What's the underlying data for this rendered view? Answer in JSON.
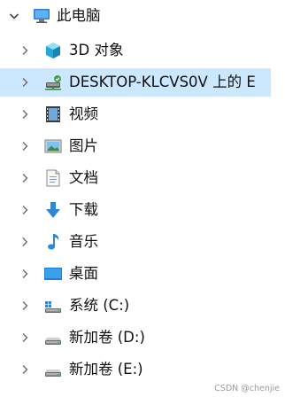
{
  "tree": {
    "root": {
      "label": "此电脑",
      "icon": "this-pc-icon",
      "expanded": true
    },
    "items": [
      {
        "label": "3D 对象",
        "icon": "3d-objects-icon"
      },
      {
        "label": "DESKTOP-KLCVS0V 上的 E",
        "icon": "network-drive-icon",
        "selected": true
      },
      {
        "label": "视频",
        "icon": "videos-icon"
      },
      {
        "label": "图片",
        "icon": "pictures-icon"
      },
      {
        "label": "文档",
        "icon": "documents-icon"
      },
      {
        "label": "下载",
        "icon": "downloads-icon"
      },
      {
        "label": "音乐",
        "icon": "music-icon"
      },
      {
        "label": "桌面",
        "icon": "desktop-icon"
      },
      {
        "label": "系统 (C:)",
        "icon": "system-drive-icon"
      },
      {
        "label": "新加卷 (D:)",
        "icon": "local-drive-icon"
      },
      {
        "label": "新加卷 (E:)",
        "icon": "local-drive-icon"
      }
    ]
  },
  "watermark": "CSDN @chenjie",
  "colors": {
    "selection": "#cce8ff",
    "chevron": "#6a6a6a"
  }
}
